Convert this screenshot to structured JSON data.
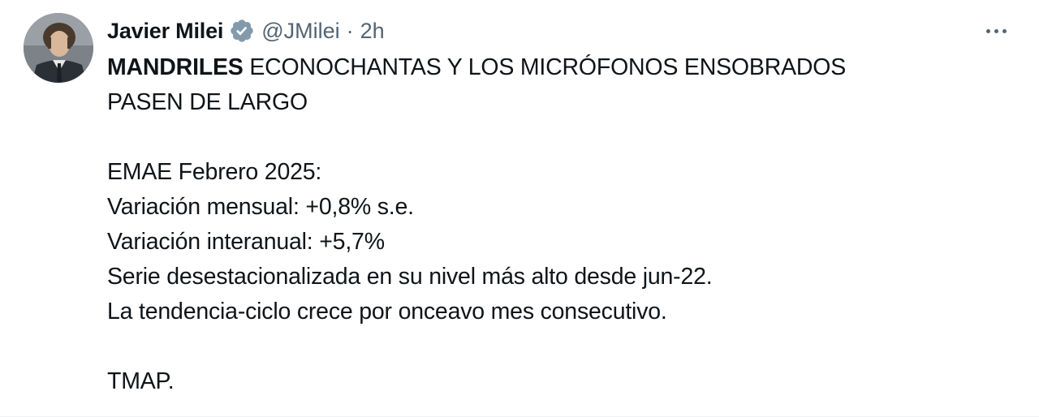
{
  "tweet": {
    "author": {
      "name": "Javier Milei",
      "handle": "@JMilei",
      "separator": "·",
      "time": "2h",
      "verified_color": "#829aab"
    },
    "more_icon": "more-horizontal-icon",
    "text": {
      "line1_bold": "MANDRILES",
      "line1_rest": " ECONOCHANTAS Y LOS MICRÓFONOS ENSOBRADOS",
      "line2": "PASEN DE LARGO",
      "line3": "EMAE Febrero 2025:",
      "line4": "Variación mensual: +0,8% s.e.",
      "line5": "Variación interanual: +5,7%",
      "line6": "Serie desestacionalizada en su nivel más alto desde jun-22.",
      "line7": "La tendencia-ciclo crece por onceavo mes consecutivo.",
      "line8": "TMAP."
    }
  }
}
